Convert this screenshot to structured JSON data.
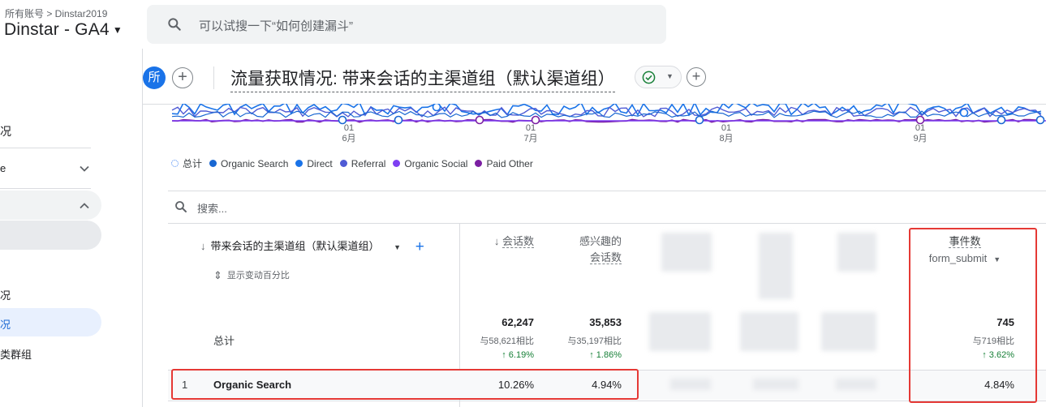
{
  "header": {
    "breadcrumb": "所有账号 > Dinstar2019",
    "account": "Dinstar - GA4",
    "search_placeholder": "可以试搜一下“如何创建漏斗”"
  },
  "sidebar": {
    "items": [
      "况",
      "e",
      "",
      "",
      "况",
      "况",
      "类群组"
    ]
  },
  "title_row": {
    "avatar": "所",
    "report_title": "流量获取情况: 带来会话的主渠道组（默认渠道组）"
  },
  "chart_data": {
    "type": "line",
    "x_ticks": [
      {
        "day": "01",
        "month": "6月"
      },
      {
        "day": "01",
        "month": "7月"
      },
      {
        "day": "01",
        "month": "8月"
      },
      {
        "day": "01",
        "month": "9月"
      }
    ],
    "legend": [
      {
        "name": "总计",
        "color": "#4285f4",
        "dotted": true
      },
      {
        "name": "Organic Search",
        "color": "#1967d2"
      },
      {
        "name": "Direct",
        "color": "#1a73e8"
      },
      {
        "name": "Referral",
        "color": "#4f5bd5"
      },
      {
        "name": "Organic Social",
        "color": "#7e3ff2"
      },
      {
        "name": "Paid Other",
        "color": "#7b1fa2"
      }
    ]
  },
  "table": {
    "search_placeholder": "搜索...",
    "dimension_header": "带来会话的主渠道组（默认渠道组）",
    "toggle_label": "显示变动百分比",
    "columns": [
      {
        "label": "会话数",
        "sorted": true
      },
      {
        "label": "兴趣的",
        "label2": "会话数"
      },
      {
        "label": "事件数",
        "label2": "form_submit"
      }
    ],
    "total_label": "总计",
    "totals": {
      "sessions": {
        "value": "62,247",
        "compare": "与58,621相比",
        "change": "↑ 6.19%"
      },
      "engaged": {
        "value": "35,853",
        "compare": "与35,197相比",
        "change": "↑ 1.86%"
      },
      "events": {
        "value": "745",
        "compare": "与719相比",
        "change": "↑ 3.62%"
      }
    },
    "rows": [
      {
        "index": "1",
        "channel": "Organic Search",
        "sessions": "10.26%",
        "engaged": "4.94%",
        "events": "4.84%"
      }
    ]
  }
}
